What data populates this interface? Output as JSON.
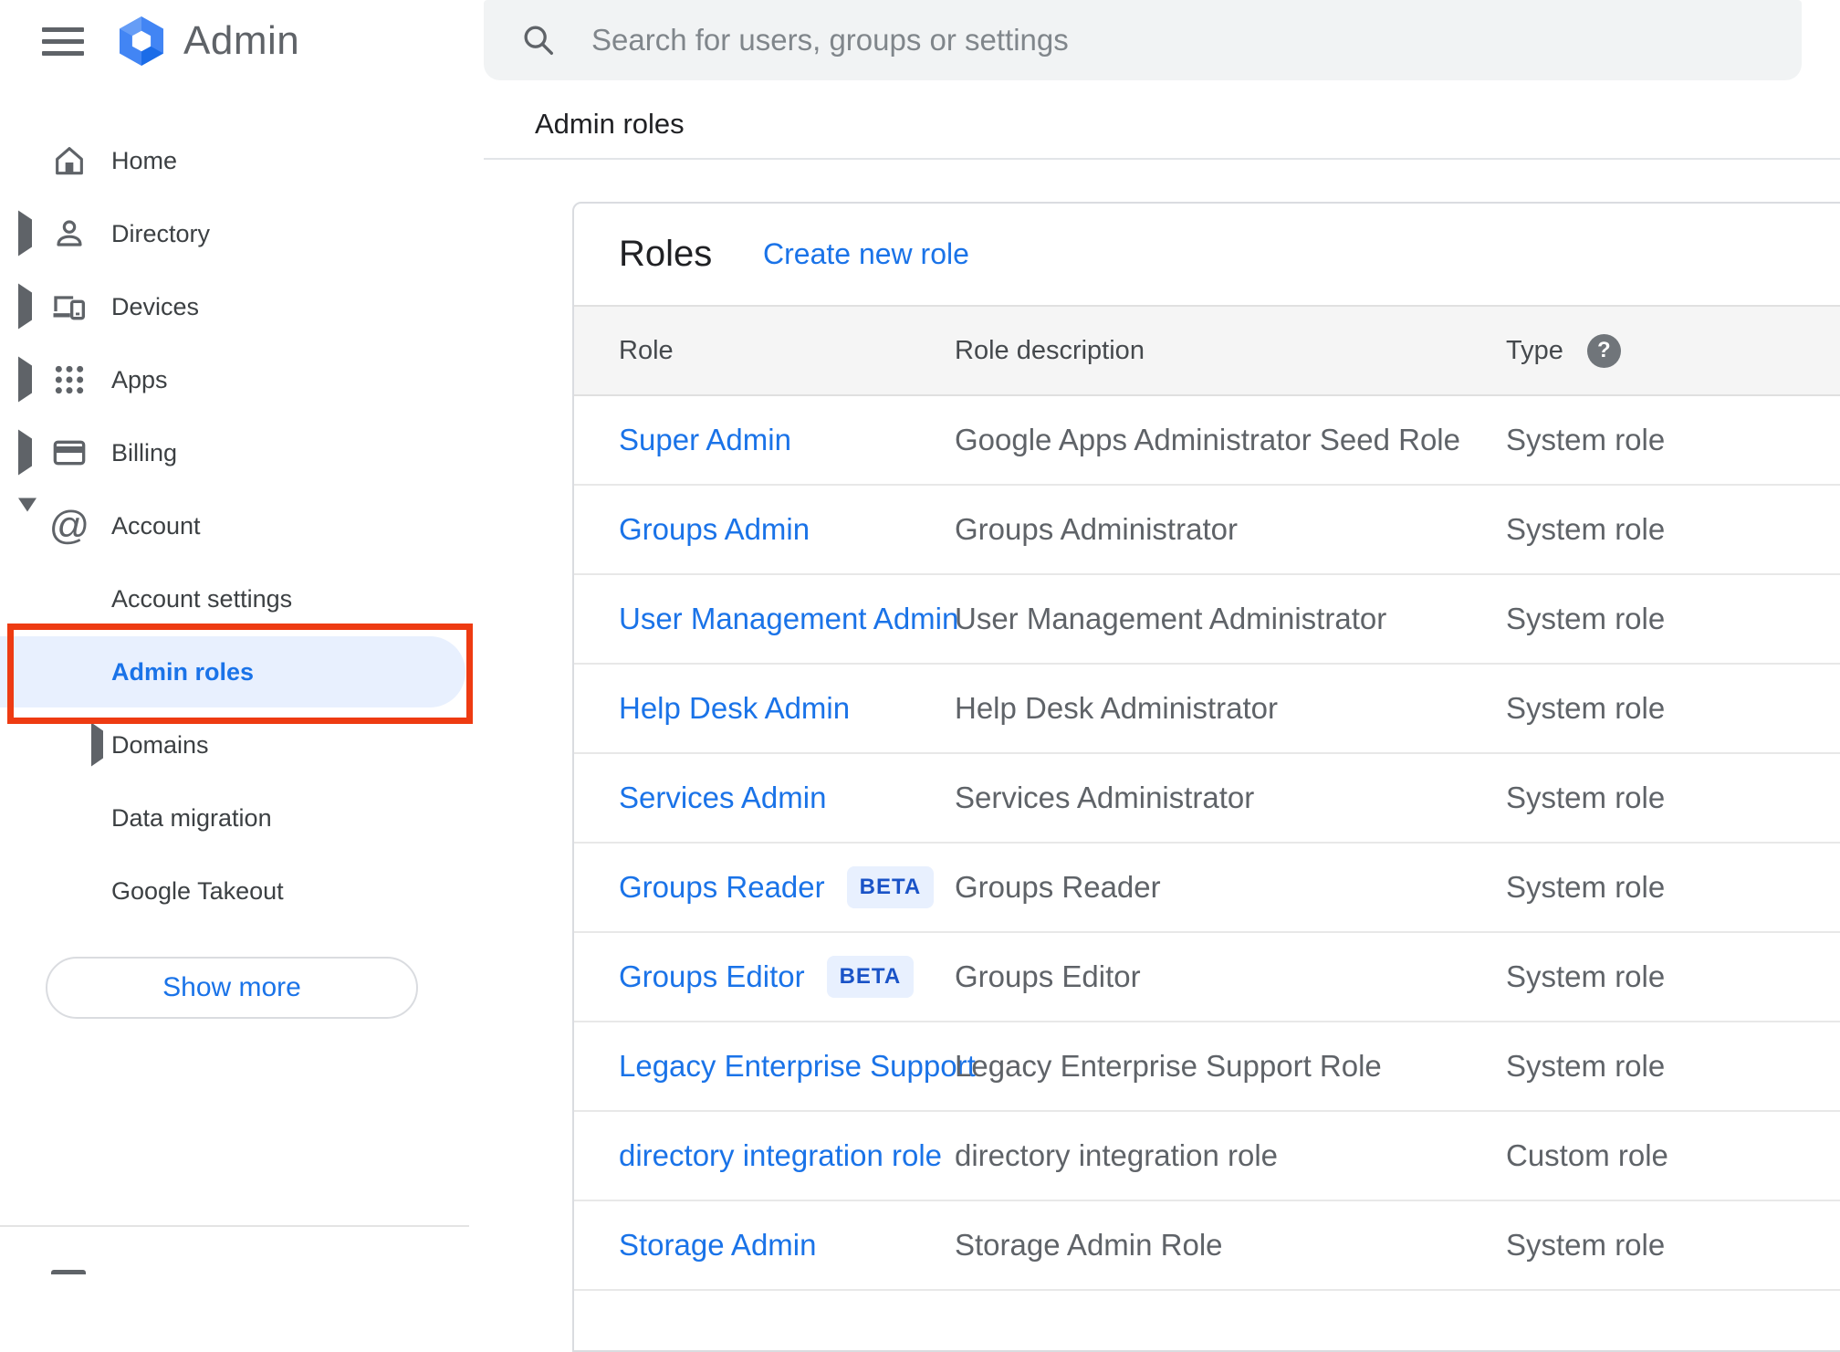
{
  "app": {
    "logo_text": "Admin"
  },
  "search": {
    "placeholder": "Search for users, groups or settings"
  },
  "breadcrumb": "Admin roles",
  "sidebar": {
    "items": [
      {
        "label": "Home",
        "icon": "home-icon",
        "expander": "none"
      },
      {
        "label": "Directory",
        "icon": "person-icon",
        "expander": "collapsed"
      },
      {
        "label": "Devices",
        "icon": "devices-icon",
        "expander": "collapsed"
      },
      {
        "label": "Apps",
        "icon": "apps-grid-icon",
        "expander": "collapsed"
      },
      {
        "label": "Billing",
        "icon": "card-icon",
        "expander": "collapsed"
      },
      {
        "label": "Account",
        "icon": "at-sign-icon",
        "expander": "expanded"
      }
    ],
    "sub_items": [
      {
        "label": "Account settings",
        "active": false,
        "expander": "none"
      },
      {
        "label": "Admin roles",
        "active": true,
        "expander": "none"
      },
      {
        "label": "Domains",
        "active": false,
        "expander": "collapsed"
      },
      {
        "label": "Data migration",
        "active": false,
        "expander": "none"
      },
      {
        "label": "Google Takeout",
        "active": false,
        "expander": "none"
      }
    ],
    "show_more_label": "Show more"
  },
  "main": {
    "card_title": "Roles",
    "create_link_label": "Create new role",
    "table": {
      "columns": [
        "Role",
        "Role description",
        "Type"
      ],
      "beta_label": "BETA",
      "rows": [
        {
          "role": "Super Admin",
          "beta": false,
          "description": "Google Apps Administrator Seed Role",
          "type": "System role"
        },
        {
          "role": "Groups Admin",
          "beta": false,
          "description": "Groups Administrator",
          "type": "System role"
        },
        {
          "role": "User Management Admin",
          "beta": false,
          "description": "User Management Administrator",
          "type": "System role"
        },
        {
          "role": "Help Desk Admin",
          "beta": false,
          "description": "Help Desk Administrator",
          "type": "System role"
        },
        {
          "role": "Services Admin",
          "beta": false,
          "description": "Services Administrator",
          "type": "System role"
        },
        {
          "role": "Groups Reader",
          "beta": true,
          "description": "Groups Reader",
          "type": "System role"
        },
        {
          "role": "Groups Editor",
          "beta": true,
          "description": "Groups Editor",
          "type": "System role"
        },
        {
          "role": "Legacy Enterprise Support",
          "beta": false,
          "description": "Legacy Enterprise Support Role",
          "type": "System role"
        },
        {
          "role": "directory integration role",
          "beta": false,
          "description": "directory integration role",
          "type": "Custom role"
        },
        {
          "role": "Storage Admin",
          "beta": false,
          "description": "Storage Admin Role",
          "type": "System role"
        }
      ]
    }
  },
  "colors": {
    "accent_blue": "#1a73e8",
    "annotation_red": "#ee3b12",
    "active_item_bg": "#e8f0fe",
    "beta_badge_bg": "#e8f0fe",
    "beta_badge_text": "#1a53c7",
    "table_header_bg": "#f5f5f5",
    "search_bar_bg": "#f1f3f4",
    "icon_gray": "#5f6368"
  }
}
